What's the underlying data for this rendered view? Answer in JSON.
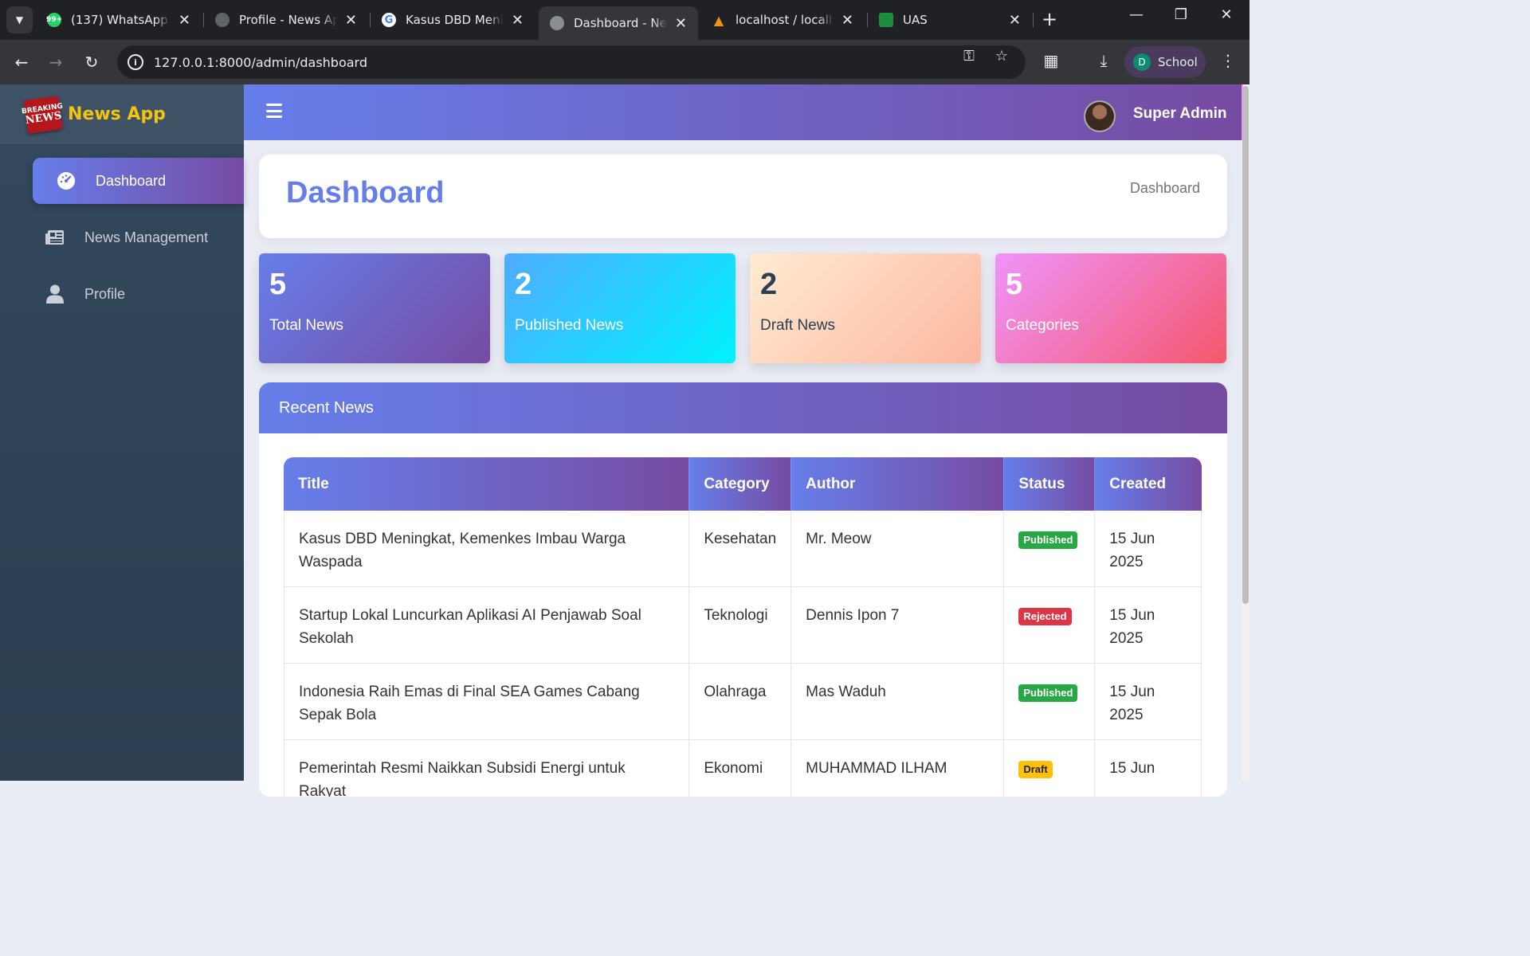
{
  "browser": {
    "tabs": [
      {
        "title": "(137) WhatsApp",
        "favicon": "whatsapp-icon",
        "badge": "99+"
      },
      {
        "title": "Profile - News App",
        "favicon": "globe-icon"
      },
      {
        "title": "Kasus DBD Meningk",
        "favicon": "google-icon"
      },
      {
        "title": "Dashboard - News",
        "favicon": "globe-icon",
        "active": true
      },
      {
        "title": "localhost / localho",
        "favicon": "phpmyadmin-icon"
      },
      {
        "title": "UAS",
        "favicon": "classroom-icon"
      }
    ],
    "url": "127.0.0.1:8000/admin/dashboard",
    "profile": {
      "initial": "D",
      "name": "School"
    }
  },
  "app": {
    "brand": {
      "name": "News App",
      "logo_top": "BREAKING",
      "logo_bottom": "NEWS"
    },
    "sidebar": {
      "items": [
        {
          "label": "Dashboard",
          "icon": "gauge-icon",
          "active": true
        },
        {
          "label": "News Management",
          "icon": "newspaper-icon"
        },
        {
          "label": "Profile",
          "icon": "user-icon"
        }
      ]
    },
    "topbar": {
      "user_name": "Super Admin"
    },
    "header": {
      "title": "Dashboard",
      "breadcrumb": "Dashboard"
    },
    "stats": [
      {
        "value": "5",
        "label": "Total News",
        "gradient": [
          "#667eea",
          "#764ba2"
        ],
        "text_color": "#ffffff"
      },
      {
        "value": "2",
        "label": "Published News",
        "gradient": [
          "#4facfe",
          "#00f2fe"
        ],
        "text_color": "#ffffff"
      },
      {
        "value": "2",
        "label": "Draft News",
        "gradient": [
          "#ffecd2",
          "#fcb69f"
        ],
        "text_color": "#2c3e50"
      },
      {
        "value": "5",
        "label": "Categories",
        "gradient": [
          "#f093fb",
          "#f5576c"
        ],
        "text_color": "#ffffff"
      }
    ],
    "recent_news": {
      "heading": "Recent News",
      "columns": [
        "Title",
        "Category",
        "Author",
        "Status",
        "Created"
      ],
      "rows": [
        {
          "title": "Kasus DBD Meningkat, Kemenkes Imbau Warga Waspada",
          "category": "Kesehatan",
          "author": "Mr. Meow",
          "status": "Published",
          "created": "15 Jun 2025"
        },
        {
          "title": "Startup Lokal Luncurkan Aplikasi AI Penjawab Soal Sekolah",
          "category": "Teknologi",
          "author": "Dennis Ipon 7",
          "status": "Rejected",
          "created": "15 Jun 2025"
        },
        {
          "title": "Indonesia Raih Emas di Final SEA Games Cabang Sepak Bola",
          "category": "Olahraga",
          "author": "Mas Waduh",
          "status": "Published",
          "created": "15 Jun 2025"
        },
        {
          "title": "Pemerintah Resmi Naikkan Subsidi Energi untuk Rakyat",
          "category": "Ekonomi",
          "author": "MUHAMMAD ILHAM",
          "status": "Draft",
          "created": "15 Jun"
        }
      ]
    }
  }
}
